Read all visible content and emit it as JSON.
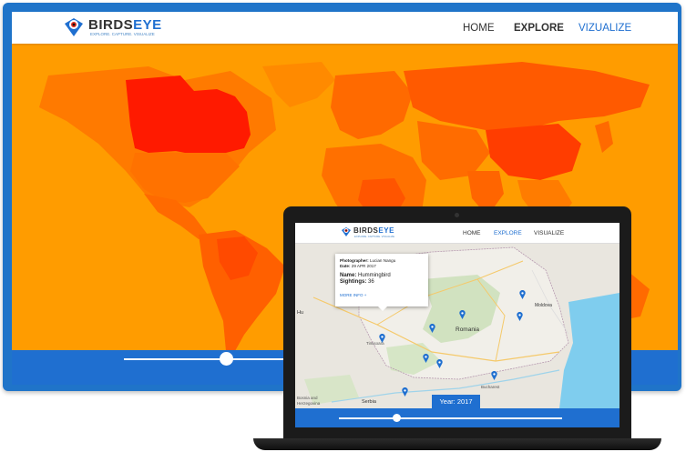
{
  "desktop": {
    "brand": {
      "name_part1": "BIRDS",
      "name_part2": "EYE",
      "tagline": "EXPLORE. CAPTURE. VISUALIZE"
    },
    "nav": {
      "home": "HOME",
      "explore": "EXPLORE",
      "vizualize": "VIZUALIZE"
    },
    "slider": {
      "level": 0.59
    }
  },
  "laptop": {
    "brand": {
      "name_part1": "BIRDS",
      "name_part2": "EYE",
      "tagline": "EXPLORE. CAPTURE. VISUALIZE"
    },
    "nav": {
      "home": "HOME",
      "explore": "EXPLORE",
      "visualize": "VISUALIZE"
    },
    "popup": {
      "photographer_label": "Photographer:",
      "photographer": "Lucian Nangu",
      "date_label": "Date:",
      "date": "29 APR 2017",
      "name_label": "Name:",
      "name": "Hummingbird",
      "sightings_label": "Sightings:",
      "sightings": "36",
      "more_info": "MORE INFO +"
    },
    "map_labels": {
      "country": "Romania",
      "serbia": "Serbia",
      "moldova": "Moldova",
      "bucharest": "Bucharest",
      "timisoara": "Timișoara",
      "bosnia": "Bosnia and Herzegovina",
      "hungary": "Hu"
    },
    "year": {
      "label": "Year:",
      "value": "2017"
    },
    "slider": {
      "level": 0.25
    }
  },
  "colors": {
    "brand_blue": "#1f6fd0",
    "map_base": "#ff9c00",
    "map_mid": "#ff7a00",
    "map_dark": "#ff5a00",
    "map_high": "#ff1a00",
    "pin_blue": "#1f6fd0",
    "water": "#7fcdee"
  }
}
